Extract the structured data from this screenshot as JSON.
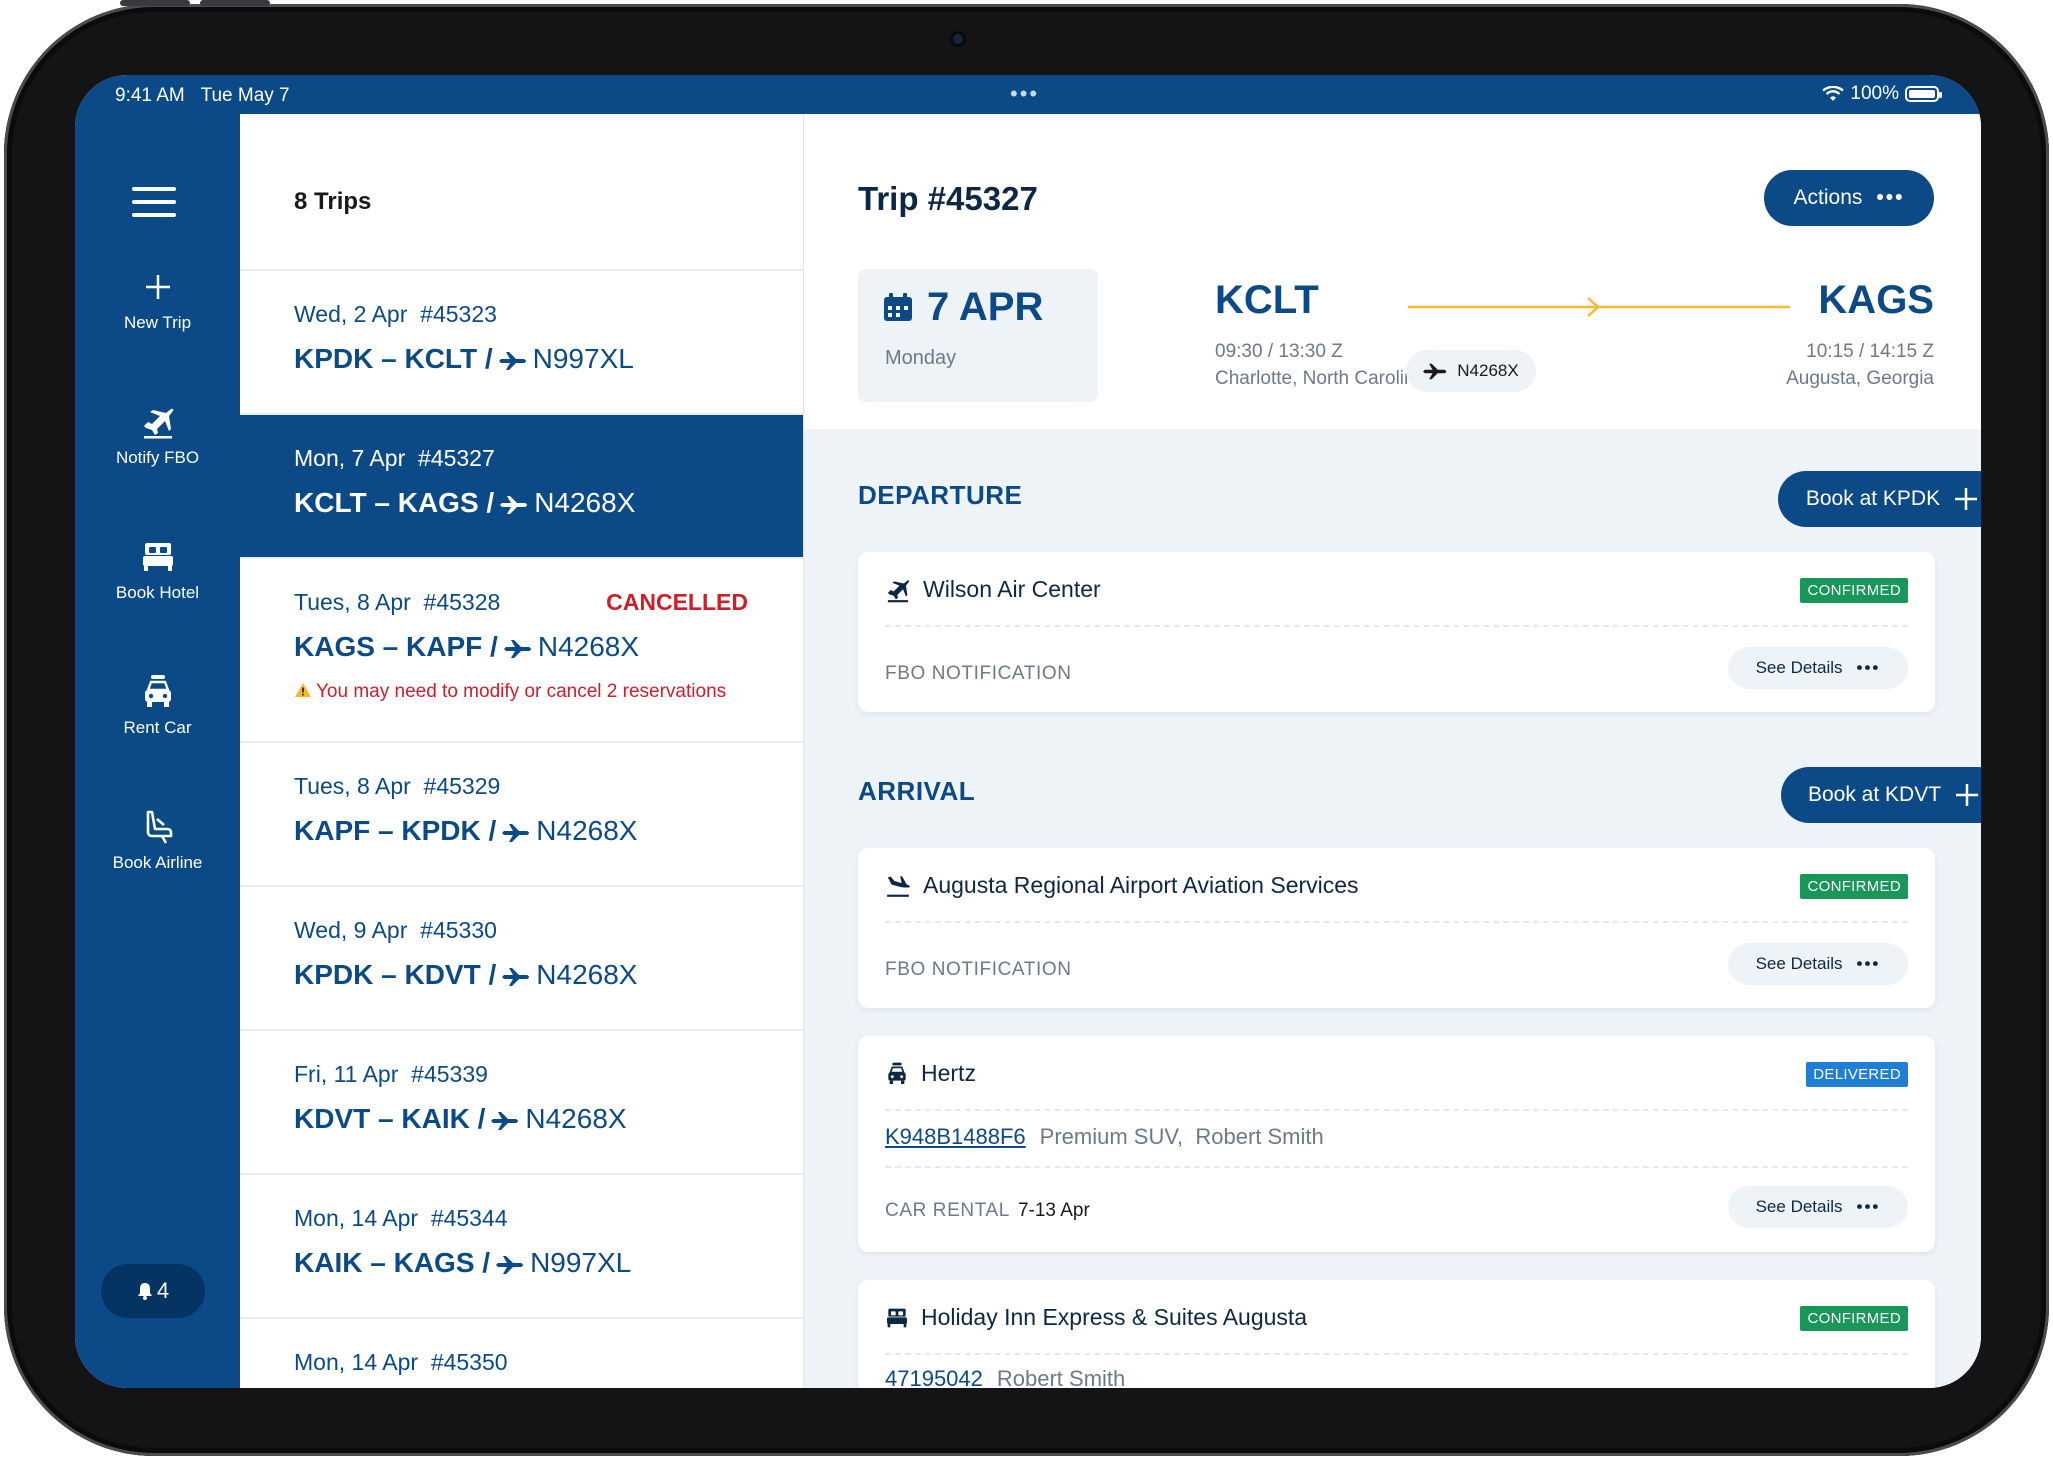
{
  "status": {
    "time": "9:41 AM",
    "date": "Tue May 7",
    "battery": "100%"
  },
  "rail": {
    "items": [
      {
        "label": "New Trip",
        "icon": "plus-icon"
      },
      {
        "label": "Notify FBO",
        "icon": "plane-departure-icon"
      },
      {
        "label": "Book Hotel",
        "icon": "bed-icon"
      },
      {
        "label": "Rent Car",
        "icon": "car-icon"
      },
      {
        "label": "Book Airline",
        "icon": "seat-icon"
      }
    ],
    "notifications": "4"
  },
  "list": {
    "count_label": "8 Trips",
    "trips": [
      {
        "date": "Wed, 2 Apr",
        "id": "#45323",
        "from": "KPDK",
        "to": "KCLT",
        "tail": "N997XL"
      },
      {
        "date": "Mon, 7 Apr",
        "id": "#45327",
        "from": "KCLT",
        "to": "KAGS",
        "tail": "N4268X",
        "selected": true
      },
      {
        "date": "Tues, 8 Apr",
        "id": "#45328",
        "from": "KAGS",
        "to": "KAPF",
        "tail": "N4268X",
        "status": "CANCELLED",
        "warning": "You may need to modify or cancel 2 reservations"
      },
      {
        "date": "Tues, 8 Apr",
        "id": "#45329",
        "from": "KAPF",
        "to": "KPDK",
        "tail": "N4268X"
      },
      {
        "date": "Wed, 9 Apr",
        "id": "#45330",
        "from": "KPDK",
        "to": "KDVT",
        "tail": "N4268X"
      },
      {
        "date": "Fri, 11 Apr",
        "id": "#45339",
        "from": "KDVT",
        "to": "KAIK",
        "tail": "N4268X"
      },
      {
        "date": "Mon, 14 Apr",
        "id": "#45344",
        "from": "KAIK",
        "to": "KAGS",
        "tail": "N997XL"
      },
      {
        "date": "Mon, 14 Apr",
        "id": "#45350"
      }
    ]
  },
  "detail": {
    "title": "Trip #45327",
    "actions_label": "Actions",
    "date_big": "7 APR",
    "date_day": "Monday",
    "origin": {
      "code": "KCLT",
      "times": "09:30 / 13:30 Z",
      "city": "Charlotte, North Carolina"
    },
    "destination": {
      "code": "KAGS",
      "times": "10:15 / 14:15 Z",
      "city": "Augusta, Georgia"
    },
    "tail": "N4268X",
    "accent": "#f5b82e",
    "departure": {
      "heading": "DEPARTURE",
      "book_label": "Book at KPDK",
      "card": {
        "name": "Wilson Air Center",
        "badge": "CONFIRMED",
        "type": "FBO NOTIFICATION",
        "details": "See Details"
      }
    },
    "arrival": {
      "heading": "ARRIVAL",
      "book_label": "Book at KDVT",
      "fbo": {
        "name": "Augusta Regional Airport Aviation Services",
        "badge": "CONFIRMED",
        "type": "FBO NOTIFICATION",
        "details": "See Details"
      },
      "car": {
        "name": "Hertz",
        "badge": "DELIVERED",
        "conf": "K948B1488F6",
        "desc": "Premium SUV,",
        "person": "Robert Smith",
        "type": "CAR RENTAL",
        "dates": "7-13 Apr",
        "details": "See Details"
      },
      "hotel": {
        "name": "Holiday Inn Express & Suites Augusta",
        "badge": "CONFIRMED",
        "conf": "47195042",
        "person": "Robert Smith"
      }
    }
  }
}
